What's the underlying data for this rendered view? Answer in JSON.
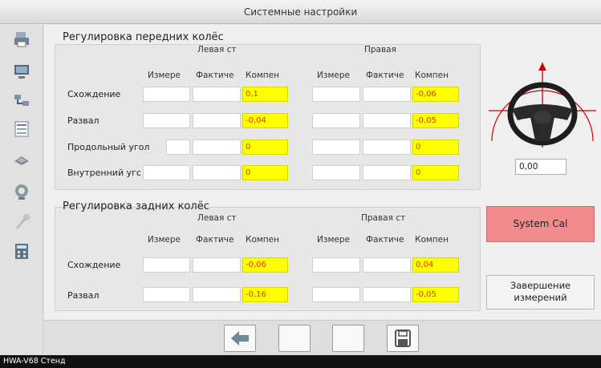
{
  "window": {
    "title": "Системные настройки"
  },
  "front": {
    "title": "Регулировка передних колёс",
    "left_label": "Левая ст",
    "right_label": "Правая",
    "col_headers": [
      "Измере",
      "Фактиче",
      "Компен"
    ],
    "rows": [
      {
        "label": "Схождение",
        "left_comp": "0,1",
        "right_comp": "-0,06"
      },
      {
        "label": "Развал",
        "left_comp": "-0,04",
        "right_comp": "-0,05"
      },
      {
        "label": "Продольный угол",
        "left_comp": "0",
        "right_comp": "0"
      },
      {
        "label": "Внутренний угс",
        "left_comp": "0",
        "right_comp": "0"
      }
    ]
  },
  "rear": {
    "title": "Регулировка задних колёс",
    "left_label": "Левая ст",
    "right_label": "Правая ст",
    "col_headers": [
      "Измере",
      "Фактиче",
      "Компен"
    ],
    "rows": [
      {
        "label": "Схождение",
        "left_comp": "-0,06",
        "right_comp": "0,04"
      },
      {
        "label": "Развал",
        "left_comp": "-0,16",
        "right_comp": "-0,05"
      }
    ]
  },
  "steering": {
    "value": "0,00"
  },
  "buttons": {
    "system_cal": "System Cal",
    "finish_line1": "Завершение",
    "finish_line2": "измерений"
  },
  "sidebar": {
    "icons": [
      "printer-icon",
      "computer-icon",
      "network-icon",
      "document-list-icon",
      "car-lift-icon",
      "webcam-icon",
      "wrench-icon",
      "calculator-icon"
    ]
  },
  "toolbar": {
    "icons": [
      "back-arrow-icon",
      "blank-button",
      "blank-button",
      "save-icon"
    ]
  },
  "status": {
    "text": "HWA-V68 Стенд"
  },
  "colors": {
    "highlight": "#ffff00",
    "highlight_text": "#d04000",
    "syscal": "#f28b8b",
    "wheel_line": "#cc0000"
  }
}
